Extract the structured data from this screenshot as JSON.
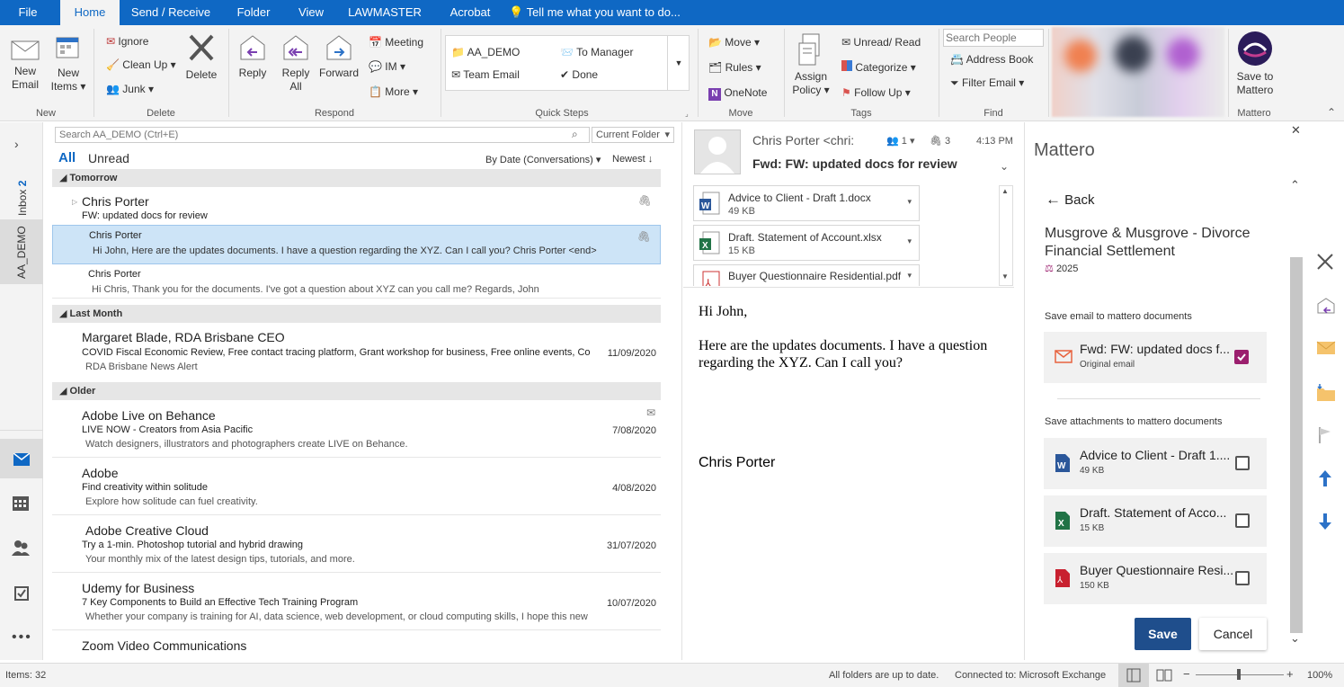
{
  "tabs": [
    "File",
    "Home",
    "Send / Receive",
    "Folder",
    "View",
    "LAWMASTER",
    "Acrobat"
  ],
  "tell_me": "Tell me what you want to do...",
  "ribbon": {
    "new_email": [
      "New",
      "Email"
    ],
    "new_items": [
      "New",
      "Items ▾"
    ],
    "ignore": "Ignore",
    "clean_up": "Clean Up ▾",
    "junk": "Junk ▾",
    "delete": "Delete",
    "reply": "Reply",
    "reply_all": [
      "Reply",
      "All"
    ],
    "forward": "Forward",
    "meeting": "Meeting",
    "im": "IM ▾",
    "more": "More ▾",
    "qs_aa_demo": "AA_DEMO",
    "qs_team_email": "Team Email",
    "qs_to_manager": "To Manager",
    "qs_done": "Done",
    "move": "Move ▾",
    "rules": "Rules ▾",
    "onenote": "OneNote",
    "assign_policy": [
      "Assign",
      "Policy ▾"
    ],
    "unread_read": "Unread/ Read",
    "categorize": "Categorize ▾",
    "follow_up": "Follow Up ▾",
    "search_people": "Search People",
    "address_book": "Address Book",
    "filter_email": "Filter Email ▾",
    "save_to_mattero": [
      "Save to",
      "Mattero"
    ],
    "groups": {
      "new": "New",
      "delete": "Delete",
      "respond": "Respond",
      "quick_steps": "Quick Steps",
      "move": "Move",
      "tags": "Tags",
      "find": "Find",
      "mattero": "Mattero"
    }
  },
  "leftnav": {
    "inbox": "Inbox",
    "inbox_count": "2",
    "aa_demo": "AA_DEMO"
  },
  "list": {
    "search_placeholder": "Search AA_DEMO (Ctrl+E)",
    "scope": "Current Folder",
    "filter_all": "All",
    "filter_unread": "Unread",
    "sort": "By Date (Conversations) ▾",
    "order": "Newest ↓",
    "groups": {
      "tomorrow": "Tomorrow",
      "last_month": "Last Month",
      "older": "Older"
    },
    "items": [
      {
        "sender": "Chris Porter",
        "subject": "FW: updated docs for review",
        "preview": "",
        "date": ""
      },
      {
        "sender": "Chris Porter",
        "subject": "",
        "preview": "Hi John,  Here are the updates documents. I have a question regarding the XYZ. Can I call you?  Chris Porter <end>",
        "date": ""
      },
      {
        "sender": "Chris Porter",
        "subject": "",
        "preview": "Hi Chris,  Thank you for the documents.  I've got a question about XYZ  can you call me?  Regards,  John",
        "date": ""
      },
      {
        "sender": "Margaret Blade, RDA Brisbane CEO",
        "subject": "COVID Fiscal Economic Review, Free contact tracing platform, Grant workshop for business, Free online events, Com...",
        "preview": "RDA Brisbane News Alert",
        "date": "11/09/2020"
      },
      {
        "sender": "Adobe Live on Behance",
        "subject": "LIVE NOW - Creators from Asia Pacific",
        "preview": "Watch designers, illustrators and photographers create LIVE on Behance.",
        "date": "7/08/2020"
      },
      {
        "sender": "Adobe",
        "subject": "Find creativity within solitude",
        "preview": "Explore how solitude can fuel creativity.",
        "date": "4/08/2020"
      },
      {
        "sender": "Adobe Creative Cloud",
        "subject": "Try a 1-min. Photoshop tutorial and hybrid drawing",
        "preview": "Your monthly mix of the latest design tips, tutorials, and more.",
        "date": "31/07/2020"
      },
      {
        "sender": "Udemy for Business",
        "subject": "7 Key Components to Build an Effective Tech Training Program",
        "preview": "Whether your company is training for AI, data science, web development, or cloud computing skills, I hope this new",
        "date": "10/07/2020"
      },
      {
        "sender": "Zoom Video Communications",
        "subject": "",
        "preview": "",
        "date": ""
      }
    ]
  },
  "reading": {
    "from": "Chris Porter <chri:",
    "people_count": "1 ▾",
    "attach_count": "3",
    "time": "4:13 PM",
    "subject": "Fwd: FW: updated docs for review",
    "attachments": [
      {
        "name": "Advice to Client - Draft 1.docx",
        "size": "49 KB",
        "type": "word"
      },
      {
        "name": "Draft. Statement of Account.xlsx",
        "size": "15 KB",
        "type": "excel"
      },
      {
        "name": "Buyer Questionnaire Residential.pdf",
        "size": "",
        "type": "pdf"
      }
    ],
    "greeting": "Hi John,",
    "body": "Here are the updates documents. I have a question regarding the XYZ. Can I call you?",
    "signature": "Chris Porter"
  },
  "mattero": {
    "title": "Mattero",
    "back": "Back",
    "matter_name": "Musgrove & Musgrove - Divorce Financial Settlement",
    "matter_year": "2025",
    "save_email_label": "Save email to mattero documents",
    "email_card": {
      "name": "Fwd: FW: updated docs f...",
      "sub": "Original email"
    },
    "save_attach_label": "Save attachments to mattero documents",
    "attachments": [
      {
        "name": "Advice to Client - Draft 1....",
        "size": "49 KB"
      },
      {
        "name": "Draft. Statement of Acco...",
        "size": "15 KB"
      },
      {
        "name": "Buyer Questionnaire Resi...",
        "size": "150 KB"
      }
    ],
    "save": "Save",
    "cancel": "Cancel"
  },
  "status": {
    "items": "Items: 32",
    "folders": "All folders are up to date.",
    "connected": "Connected to: Microsoft Exchange",
    "zoom": "100%"
  },
  "colors": {
    "brand_blue": "#0f68c4",
    "selected_row": "#cde4f7",
    "mattero_purple": "#9b1f6e",
    "save_button": "#1f4e8c"
  }
}
